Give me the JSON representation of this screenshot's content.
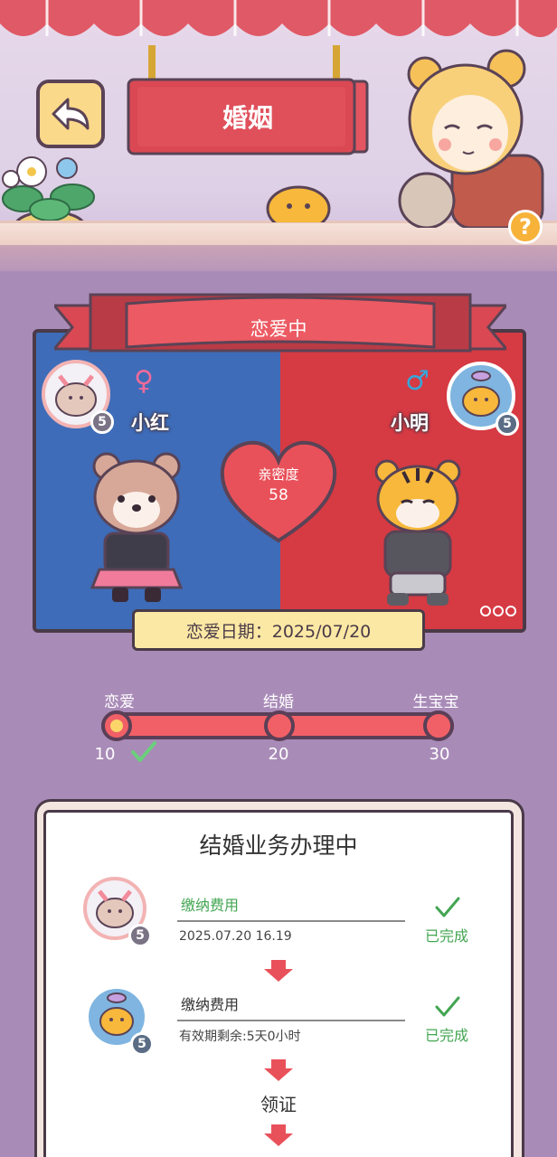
{
  "header": {
    "title": "婚姻",
    "help": "?"
  },
  "relationship": {
    "status": "恋爱中",
    "female": {
      "name": "小红",
      "gender_symbol": "♀",
      "level": "5"
    },
    "male": {
      "name": "小明",
      "gender_symbol": "♂",
      "level": "5"
    },
    "intimacy_label": "亲密度",
    "intimacy_value": "58",
    "date_text": "恋爱日期：2025/07/20"
  },
  "progress": {
    "stages": [
      {
        "label": "恋爱",
        "value": "10",
        "done": true
      },
      {
        "label": "结婚",
        "value": "20",
        "done": false
      },
      {
        "label": "生宝宝",
        "value": "30",
        "done": false
      }
    ]
  },
  "marriage_process": {
    "title": "结婚业务办理中",
    "steps": [
      {
        "title": "缴纳费用",
        "sub": "2025.07.20 16.19",
        "status": "已完成",
        "avatar_level": "5"
      },
      {
        "title": "缴纳费用",
        "sub": "有效期剩余:5天0小时",
        "status": "已完成",
        "avatar_level": "5"
      }
    ],
    "next_step": "领证"
  },
  "colors": {
    "female_panel": "#3e6cb8",
    "male_panel": "#d63a43",
    "accent_red": "#e94b53",
    "done_green": "#43a552"
  },
  "icons": [
    "back-arrow-icon",
    "female-symbol-icon",
    "male-symbol-icon",
    "heart-icon",
    "checkmark-icon",
    "down-arrow-icon",
    "more-dots-icon"
  ]
}
